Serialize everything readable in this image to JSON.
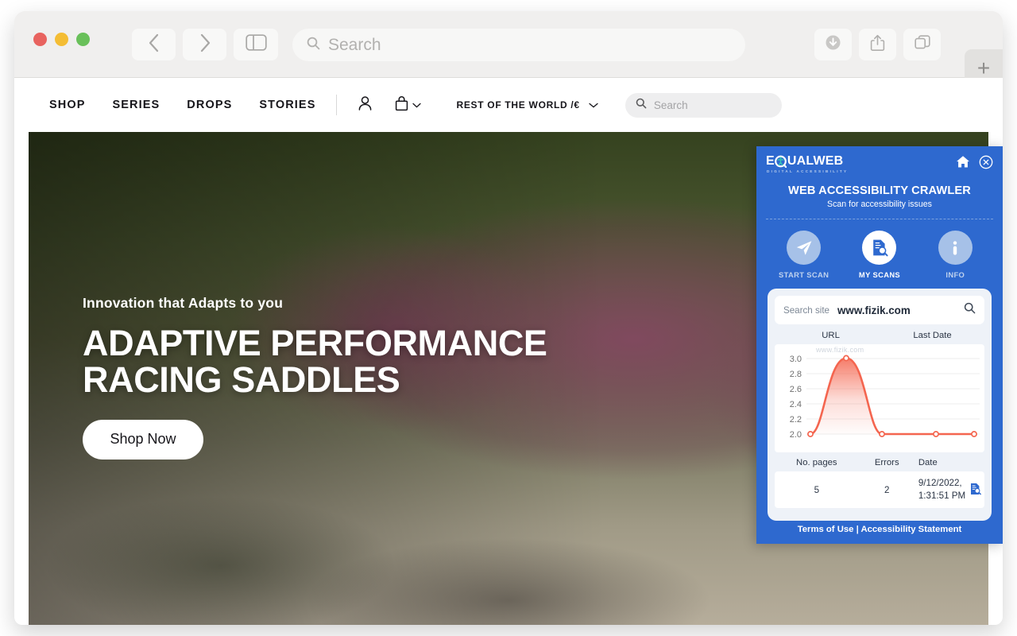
{
  "browser": {
    "traffic_lights": [
      "close",
      "minimize",
      "maximize"
    ],
    "back_icon": "chevron-left-icon",
    "forward_icon": "chevron-right-icon",
    "sidebar_icon": "sidebar-toggle-icon",
    "search_placeholder": "Search",
    "search_icon": "search-icon",
    "downloads_icon": "downloads-icon",
    "share_icon": "share-icon",
    "tabs_icon": "tab-overview-icon",
    "new_tab_label": "+"
  },
  "site": {
    "nav": [
      {
        "label": "SHOP"
      },
      {
        "label": "SERIES"
      },
      {
        "label": "DROPS"
      },
      {
        "label": "STORIES"
      }
    ],
    "account_icon": "user-icon",
    "bag_icon": "shopping-bag-icon",
    "bag_chevron": "chevron-down-icon",
    "region_label": "REST OF THE WORLD /€",
    "region_chevron": "chevron-down-icon",
    "search_placeholder": "Search",
    "search_icon": "search-icon",
    "hero": {
      "eyebrow": "Innovation that Adapts to you",
      "headline_line1": "ADAPTIVE PERFORMANCE",
      "headline_line2": "RACING SADDLES",
      "cta_label": "Shop Now"
    }
  },
  "equalweb": {
    "brand": {
      "name_part1": "E",
      "name_part2": "UALWEB",
      "tagline": "DIGITAL ACCESSIBILITY",
      "logo_person_icon": "accessibility-person-icon"
    },
    "home_icon": "home-icon",
    "close_icon": "close-circle-icon",
    "title": "WEB ACCESSIBILITY CRAWLER",
    "subtitle": "Scan for accessibility issues",
    "tabs": [
      {
        "label": "START SCAN",
        "icon": "paper-plane-icon",
        "active": false
      },
      {
        "label": "MY SCANS",
        "icon": "document-search-icon",
        "active": true
      },
      {
        "label": "INFO",
        "icon": "info-icon",
        "active": false
      }
    ],
    "search_site": {
      "label": "Search site",
      "value": "www.fizik.com",
      "icon": "search-icon"
    },
    "table_header_top": {
      "url": "URL",
      "last_date": "Last Date"
    },
    "ghost_url": "www.fizik.com",
    "table_header_bottom": {
      "pages": "No. pages",
      "errors": "Errors",
      "date": "Date"
    },
    "row": {
      "pages": "5",
      "errors": "2",
      "date_line1": "9/12/2022,",
      "date_line2": "1:31:51 PM",
      "report_icon": "report-document-icon"
    },
    "footer": "Terms of Use | Accessibility Statement",
    "colors": {
      "panel_blue": "#2e69cf",
      "chart_line": "#f4654f",
      "card_bg": "#eef2f8"
    }
  },
  "chart_data": {
    "type": "area",
    "title": "",
    "xlabel": "",
    "ylabel": "",
    "x": [
      0,
      1,
      2,
      3,
      4
    ],
    "values": [
      2.0,
      3.0,
      2.0,
      2.0,
      2.0
    ],
    "series": [
      {
        "name": "errors",
        "values": [
          2.0,
          3.0,
          2.0,
          2.0,
          2.0
        ]
      }
    ],
    "ytick_labels": [
      "3.0",
      "2.8",
      "2.6",
      "2.4",
      "2.2",
      "2.0"
    ],
    "ylim": [
      2.0,
      3.0
    ],
    "grid": true,
    "legend": "none",
    "line_color": "#f4654f",
    "interpolation": "spline",
    "markers": true
  }
}
